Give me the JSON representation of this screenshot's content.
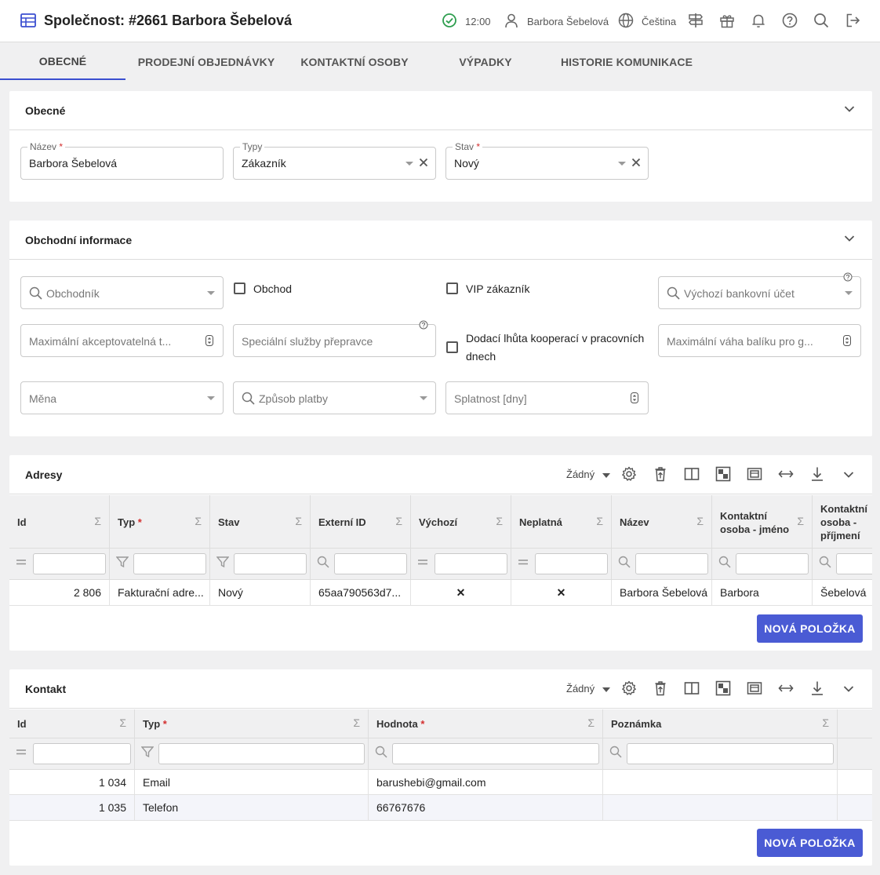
{
  "header": {
    "title": "Společnost: #2661 Barbora Šebelová",
    "time": "12:00",
    "user": "Barbora Šebelová",
    "language": "Čeština"
  },
  "tabs": [
    {
      "label": "OBECNÉ",
      "active": true
    },
    {
      "label": "PRODEJNÍ OBJEDNÁVKY"
    },
    {
      "label": "KONTAKTNÍ OSOBY"
    },
    {
      "label": "VÝPADKY"
    },
    {
      "label": "HISTORIE KOMUNIKACE"
    }
  ],
  "general": {
    "title": "Obecné",
    "name": {
      "label": "Název",
      "value": "Barbora Šebelová"
    },
    "types": {
      "label": "Typy",
      "value": "Zákazník"
    },
    "state": {
      "label": "Stav",
      "value": "Nový"
    }
  },
  "business": {
    "title": "Obchodní informace",
    "salesman_ph": "Obchodník",
    "obchod": "Obchod",
    "vip": "VIP zákazník",
    "bank_ph": "Výchozí bankovní účet",
    "max_accept_ph": "Maximální akceptovatelná t...",
    "special_ph": "Speciální služby přepravce",
    "delivery_label": "Dodací lhůta kooperací v pracovních dnech",
    "max_weight_ph": "Maximální váha balíku pro g...",
    "currency_ph": "Měna",
    "payment_ph": "Způsob platby",
    "due_ph": "Splatnost [dny]"
  },
  "addresses": {
    "title": "Adresy",
    "filter_mode": "Žádný",
    "columns": [
      "Id",
      "Typ",
      "Stav",
      "Externí ID",
      "Výchozí",
      "Neplatná",
      "Název",
      "Kontaktní osoba - jméno",
      "Kontaktní osoba - příjmení"
    ],
    "rows": [
      {
        "id": "2 806",
        "typ": "Fakturační adre...",
        "stav": "Nový",
        "ext": "65aa790563d7...",
        "vychozi": "✕",
        "neplatna": "✕",
        "nazev": "Barbora Šebelová",
        "jmeno": "Barbora",
        "prijmeni": "Šebelová"
      }
    ],
    "new_button": "NOVÁ POLOŽKA"
  },
  "contacts": {
    "title": "Kontakt",
    "filter_mode": "Žádný",
    "columns": [
      "Id",
      "Typ",
      "Hodnota",
      "Poznámka"
    ],
    "rows": [
      {
        "id": "1 034",
        "typ": "Email",
        "hodnota": "barushebi@gmail.com",
        "poznamka": ""
      },
      {
        "id": "1 035",
        "typ": "Telefon",
        "hodnota": "66767676",
        "poznamka": ""
      }
    ],
    "new_button": "NOVÁ POLOŽKA"
  },
  "colors": {
    "accent": "#4a5bd4",
    "success": "#2e9e4f",
    "required": "#d32f2f"
  }
}
